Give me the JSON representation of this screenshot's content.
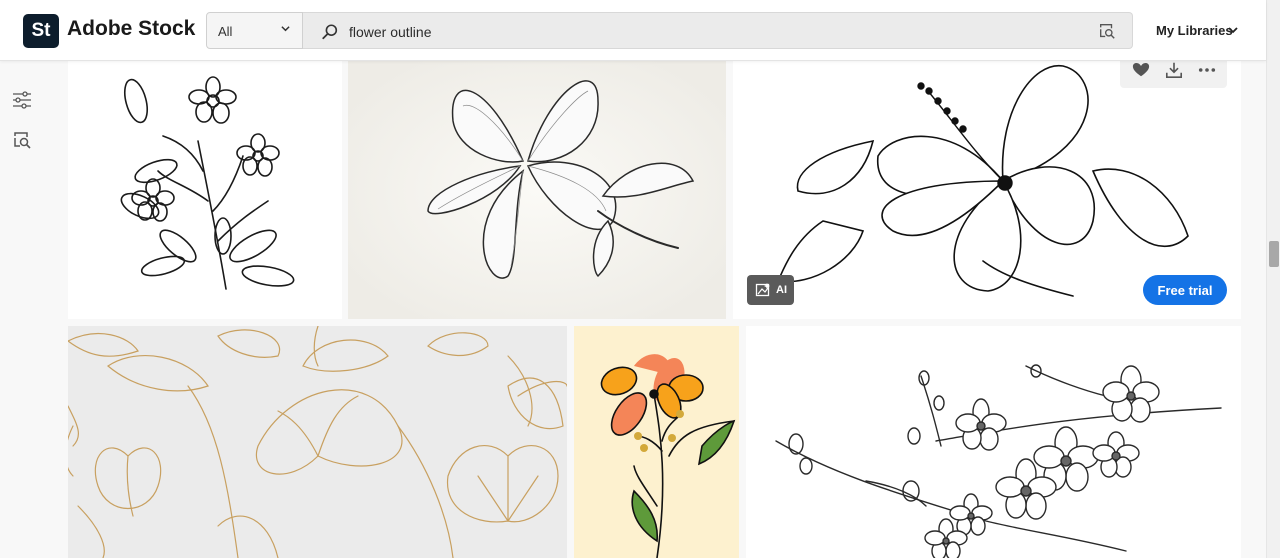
{
  "header": {
    "logo_mark": "St",
    "brand": "Adobe Stock",
    "filter": {
      "selected": "All"
    },
    "search": {
      "value": "flower outline"
    },
    "libraries_label": "My Libraries"
  },
  "sidebar": {
    "icons": [
      "filters-icon",
      "visual-search-icon"
    ]
  },
  "results": {
    "tiles": [
      {
        "subject": "jasmine-branch-line-art"
      },
      {
        "subject": "plumeria-pencil-sketch"
      },
      {
        "subject": "hibiscus-outline",
        "badge": "AI",
        "cta": "Free trial",
        "actions": [
          "heart-icon",
          "download-icon",
          "more-icon"
        ]
      },
      {
        "subject": "gold-lotus-pattern"
      },
      {
        "subject": "orange-flower-doodle"
      },
      {
        "subject": "cherry-blossom-branch-line-art"
      }
    ]
  },
  "colors": {
    "accent": "#1473e6",
    "logo_bg": "#0d1d2c",
    "gold_line": "#c8a060",
    "cream_bg": "#fdf1cf",
    "petal_orange": "#f7a21b",
    "petal_salmon": "#f48558",
    "leaf_green": "#5e9a3a"
  }
}
